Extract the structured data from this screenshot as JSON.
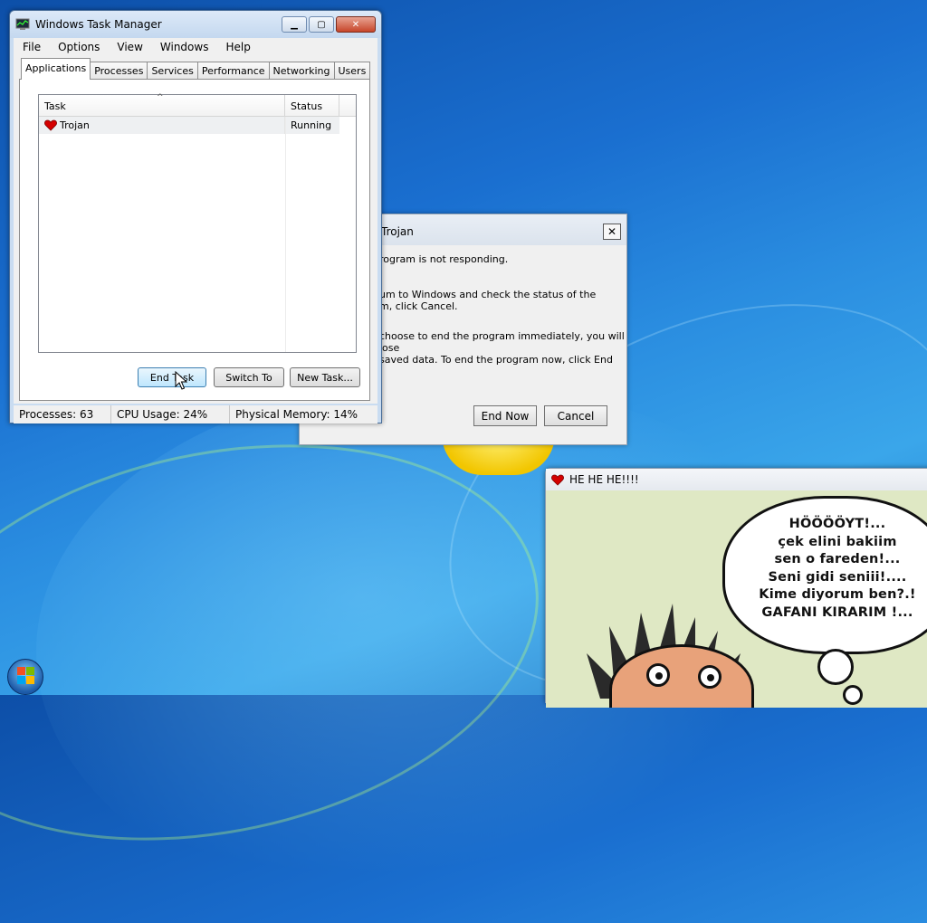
{
  "task_manager": {
    "title": "Windows Task Manager",
    "menu": [
      "File",
      "Options",
      "View",
      "Windows",
      "Help"
    ],
    "tabs": [
      "Applications",
      "Processes",
      "Services",
      "Performance",
      "Networking",
      "Users"
    ],
    "active_tab": "Applications",
    "list": {
      "columns": [
        "Task",
        "Status"
      ],
      "rows": [
        {
          "task": "Trojan",
          "status": "Running",
          "icon": "heart-icon"
        }
      ]
    },
    "buttons": {
      "end_task": "End Task",
      "switch_to": "Switch To",
      "new_task": "New Task..."
    },
    "status": {
      "processes": "Processes: 63",
      "cpu": "CPU Usage: 24%",
      "memory": "Physical Memory: 14%"
    }
  },
  "dialog": {
    "title": "Trojan",
    "line1": "rogram is not responding.",
    "line2": "um to Windows and check the status of the\nm, click Cancel.",
    "line3": "choose to end the program immediately, you will lose\nsaved data. To end the program now, click End",
    "end_now": "End Now",
    "cancel": "Cancel"
  },
  "hehe_window": {
    "title": "HE HE HE!!!!",
    "bubble_lines": [
      "HÖÖÖÖYT!...",
      "çek elini bakiim",
      "sen o fareden!...",
      "Seni gidi seniii!....",
      "Kime diyorum ben?.!",
      "GAFANI KIRARIM !..."
    ]
  },
  "colors": {
    "accent": "#3c7fb1",
    "desktop": "#1a6fd0",
    "heart": "#d40000"
  }
}
